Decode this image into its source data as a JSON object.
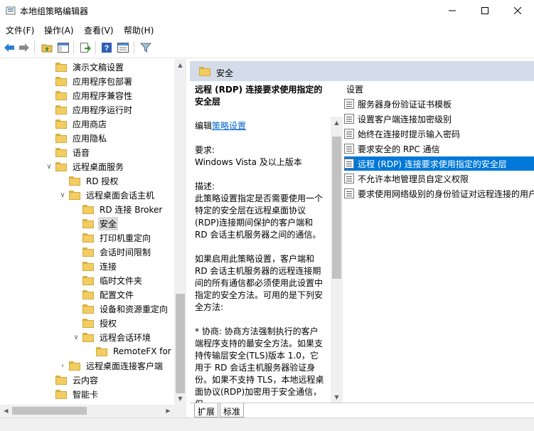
{
  "window": {
    "title": "本地组策略编辑器"
  },
  "menu": [
    "文件(F)",
    "操作(A)",
    "查看(V)",
    "帮助(H)"
  ],
  "toolbar": {
    "icons": [
      "back-arrow-icon",
      "forward-arrow-icon",
      "up-folder-icon",
      "show-hide-tree-icon",
      "export-list-icon",
      "help-icon",
      "properties-icon",
      "filter-icon"
    ]
  },
  "tree": [
    {
      "label": "演示文稿设置"
    },
    {
      "label": "应用程序包部署"
    },
    {
      "label": "应用程序兼容性"
    },
    {
      "label": "应用程序运行时"
    },
    {
      "label": "应用商店"
    },
    {
      "label": "应用隐私"
    },
    {
      "label": "语音"
    },
    {
      "label": "远程桌面服务"
    },
    {
      "label": "RD 授权"
    },
    {
      "label": "远程桌面会话主机"
    },
    {
      "label": "RD 连接 Broker"
    },
    {
      "label": "安全"
    },
    {
      "label": "打印机重定向"
    },
    {
      "label": "会话时间限制"
    },
    {
      "label": "连接"
    },
    {
      "label": "临时文件夹"
    },
    {
      "label": "配置文件"
    },
    {
      "label": "设备和资源重定向"
    },
    {
      "label": "授权"
    },
    {
      "label": "远程会话环境"
    },
    {
      "label": "RemoteFX for W"
    },
    {
      "label": "远程桌面连接客户端"
    },
    {
      "label": "云内容"
    },
    {
      "label": "智能卡"
    }
  ],
  "right": {
    "header": "安全",
    "description": {
      "title": "远程 (RDP) 连接要求使用指定的安全层",
      "edit_prefix": "编辑",
      "edit_link": "策略设置",
      "requirements_label": "要求:",
      "requirements": "Windows Vista 及以上版本",
      "desc_label": "描述:",
      "desc_text": "此策略设置指定是否需要使用一个特定的安全层在远程桌面协议(RDP)连接期间保护的客户端和 RD 会话主机服务器之间的通信。",
      "enabled_text": "如果启用此策略设置，客户端和 RD 会话主机服务器的远程连接期间的所有通信都必须使用此设置中指定的安全方法。可用的是下列安全方法:",
      "bullet_text": "* 协商: 协商方法强制执行的客户端程序支持的最安全方法。如果支持传输层安全(TLS)版本 1.0，它用于 RD 会话主机服务器验证身份。如果不支持 TLS，本地远程桌面协议(RDP)加密用于安全通信，但"
    },
    "settings_header": "设置",
    "settings": [
      {
        "label": "服务器身份验证证书模板"
      },
      {
        "label": "设置客户端连接加密级别"
      },
      {
        "label": "始终在连接时提示输入密码"
      },
      {
        "label": "要求安全的 RPC 通信"
      },
      {
        "label": "远程 (RDP) 连接要求使用指定的安全层"
      },
      {
        "label": "不允许本地管理员自定义权限"
      },
      {
        "label": "要求使用网络级别的身份验证对远程连接的用户"
      }
    ],
    "tabs": [
      "扩展",
      "标准"
    ]
  }
}
